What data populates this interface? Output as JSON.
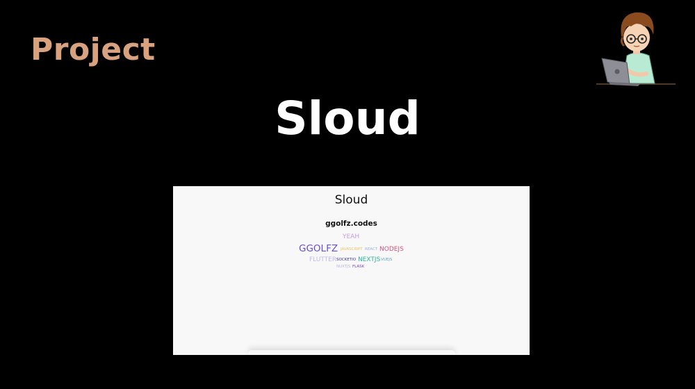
{
  "slide": {
    "section_label": "Project",
    "project_title": "Sloud"
  },
  "avatar": {
    "icon": "developer-with-laptop-icon"
  },
  "preview": {
    "app_title": "Sloud",
    "subtitle": "ggolfz.codes",
    "words": [
      {
        "text": "YEAH",
        "color": "#c79be6"
      },
      {
        "text": "GGOLFZ",
        "color": "#6a4fc7"
      },
      {
        "text": "JAVASCRIPT",
        "color": "#e9c46a"
      },
      {
        "text": "REACT",
        "color": "#9ab0e8"
      },
      {
        "text": "NODEJS",
        "color": "#d9507a"
      },
      {
        "text": "FLUTTER",
        "color": "#c4b8ec"
      },
      {
        "text": "SOCKETIO",
        "color": "#3b2f8f"
      },
      {
        "text": "NEXTJS",
        "color": "#2fb39a"
      },
      {
        "text": "VUEJS",
        "color": "#5aa3c9"
      },
      {
        "text": "NUXTJS",
        "color": "#b9b4e0"
      },
      {
        "text": "FLASK",
        "color": "#7b3fc8"
      }
    ]
  },
  "colors": {
    "background": "#000000",
    "section_label": "#d8a27e",
    "title": "#ffffff",
    "preview_bg": "#f8f8f8"
  }
}
